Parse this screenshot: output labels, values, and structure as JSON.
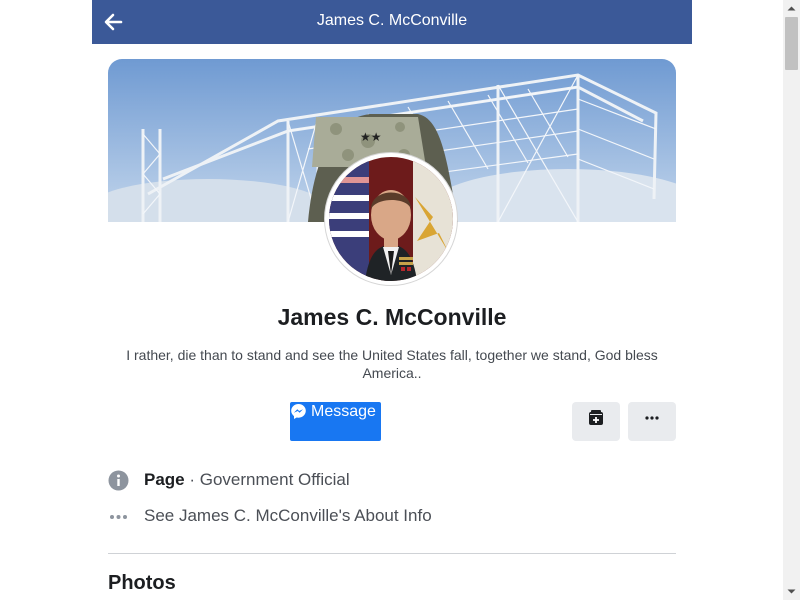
{
  "header": {
    "title": "James C. McConville",
    "back_icon": "back-arrow-icon"
  },
  "profile": {
    "name": "James C. McConville",
    "bio": "I rather, die than to stand and see the United States fall, together we stand, God bless America.."
  },
  "actions": {
    "message_label": "Message",
    "message_icon": "messenger-icon",
    "save_icon": "save-page-icon",
    "more_icon": "more-options-icon"
  },
  "info": {
    "page_label": "Page",
    "separator": " · ",
    "category": "Government Official",
    "about_text": "See James C. McConville's About Info"
  },
  "sections": {
    "photos_title": "Photos"
  },
  "colors": {
    "header_bg": "#3b5998",
    "accent": "#1877f2",
    "secondary_button": "#e9ebee"
  }
}
